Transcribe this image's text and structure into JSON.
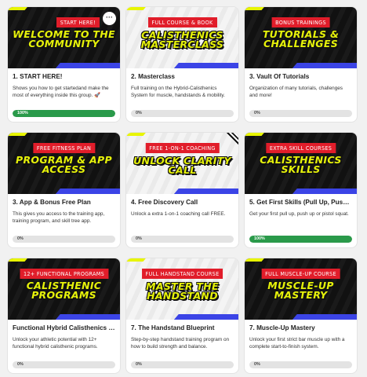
{
  "courses": [
    {
      "badge": "START HERE!",
      "art": "WELCOME TO THE COMMUNITY",
      "title": "1. START HERE!",
      "desc": "Shows you how to get startedand make the most of everything inside this group. 🚀",
      "progress": 100,
      "progress_label": "100%",
      "theme": "dark",
      "menu_icon": "ellipsis-icon",
      "menu_glyph": "···"
    },
    {
      "badge": "FULL COURSE & BOOK",
      "art": "CALISTHENICS MASTERCLASS",
      "title": "2. Masterclass",
      "desc": "Full training on the Hybrid-Calisthenics System for muscle, handstands & mobility.",
      "progress": 0,
      "progress_label": "0%",
      "theme": "light"
    },
    {
      "badge": "BONUS TRAININGS",
      "art": "TUTORIALS & CHALLENGES",
      "title": "3. Vault Of Tutorials",
      "desc": "Organization of many tutorials, challenges and more!",
      "progress": 0,
      "progress_label": "0%",
      "theme": "dark"
    },
    {
      "badge": "FREE FITNESS PLAN",
      "art": "PROGRAM & APP ACCESS",
      "title": "3. App & Bonus Free Plan",
      "desc": "This gives you access to the training app, training program, and skill tree app.",
      "progress": 0,
      "progress_label": "0%",
      "theme": "dark"
    },
    {
      "badge": "FREE 1-ON-1 COACHING",
      "art": "UNLOCK CLARITY CALL",
      "title": "4. Free Discovery Call",
      "desc": "Unlock a extra 1-on-1 coaching call FREE.",
      "progress": 0,
      "progress_label": "0%",
      "theme": "light"
    },
    {
      "badge": "EXTRA SKILL COURSES",
      "art": "CALISTHENICS SKILLS",
      "title": "5. Get First Skills (Pull Up, Push U...",
      "desc": "Get your first pull up, push up or pistol squat.",
      "progress": 100,
      "progress_label": "100%",
      "theme": "dark"
    },
    {
      "badge": "12+ FUNCTIONAL PROGRAMS",
      "art": "CALISTHENIC PROGRAMS",
      "title": "Functional Hybrid Calisthenics Pr...",
      "desc": "Unlock your athletic potential with 12+ functional hybrid calisthenic programs.",
      "progress": 0,
      "progress_label": "0%",
      "theme": "dark"
    },
    {
      "badge": "FULL HANDSTAND COURSE",
      "art": "MASTER THE HANDSTAND",
      "title": "7. The Handstand Blueprint",
      "desc": "Step-by-step handstand training program on how to build strength and balance.",
      "progress": 0,
      "progress_label": "0%",
      "theme": "light"
    },
    {
      "badge": "FULL MUSCLE-UP COURSE",
      "art": "MUSCLE-UP MASTERY",
      "title": "7. Muscle-Up Mastery",
      "desc": "Unlock your first strict bar muscle up with a complete start-to-finish system.",
      "progress": 0,
      "progress_label": "0%",
      "theme": "dark"
    }
  ],
  "colors": {
    "progress_fill": "#2a9a4a",
    "badge_red": "#e11d2a",
    "art_yellow": "#e6f20a",
    "stripe_blue": "#3b44e6"
  }
}
